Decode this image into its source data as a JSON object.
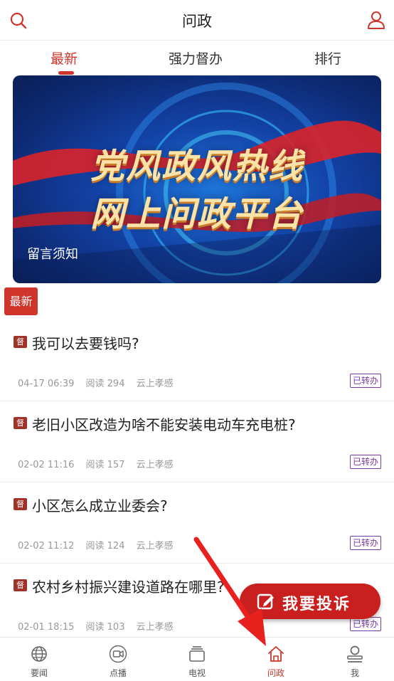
{
  "header": {
    "title": "问政",
    "search_icon": "search-icon",
    "user_icon": "user-icon"
  },
  "tabs": [
    {
      "label": "最新",
      "active": true
    },
    {
      "label": "强力督办",
      "active": false
    },
    {
      "label": "排行",
      "active": false
    }
  ],
  "banner": {
    "line1": "党风政风热线",
    "line2": "网上问政平台",
    "notice": "留言须知"
  },
  "latest_badge": "最新",
  "questions": [
    {
      "icon_text": "督",
      "title": "我可以去要钱吗?",
      "date": "04-17 06:39",
      "reads": "阅读 294",
      "source": "云上孝感",
      "status": "已转办"
    },
    {
      "icon_text": "督",
      "title": "老旧小区改造为啥不能安装电动车充电桩?",
      "date": "02-02 11:16",
      "reads": "阅读 157",
      "source": "云上孝感",
      "status": "已转办"
    },
    {
      "icon_text": "督",
      "title": "小区怎么成立业委会?",
      "date": "02-02 11:12",
      "reads": "阅读 124",
      "source": "云上孝感",
      "status": "已转办"
    },
    {
      "icon_text": "督",
      "title": "农村乡村振兴建设道路在哪里?",
      "date": "02-01 18:15",
      "reads": "阅读 103",
      "source": "云上孝感",
      "status": "已转办"
    }
  ],
  "complain_button": {
    "label": "我要投诉",
    "icon": "edit-icon"
  },
  "bottom_nav": [
    {
      "label": "要闻",
      "icon": "globe-icon",
      "active": false
    },
    {
      "label": "点播",
      "icon": "video-icon",
      "active": false
    },
    {
      "label": "电视",
      "icon": "tv-icon",
      "active": false
    },
    {
      "label": "问政",
      "icon": "home-icon",
      "active": true
    },
    {
      "label": "我",
      "icon": "profile-icon",
      "active": false
    }
  ],
  "colors": {
    "accent": "#d0352b",
    "status": "#7b3aa5",
    "complain": "#c91f1f",
    "arrow": "#e8211e"
  }
}
